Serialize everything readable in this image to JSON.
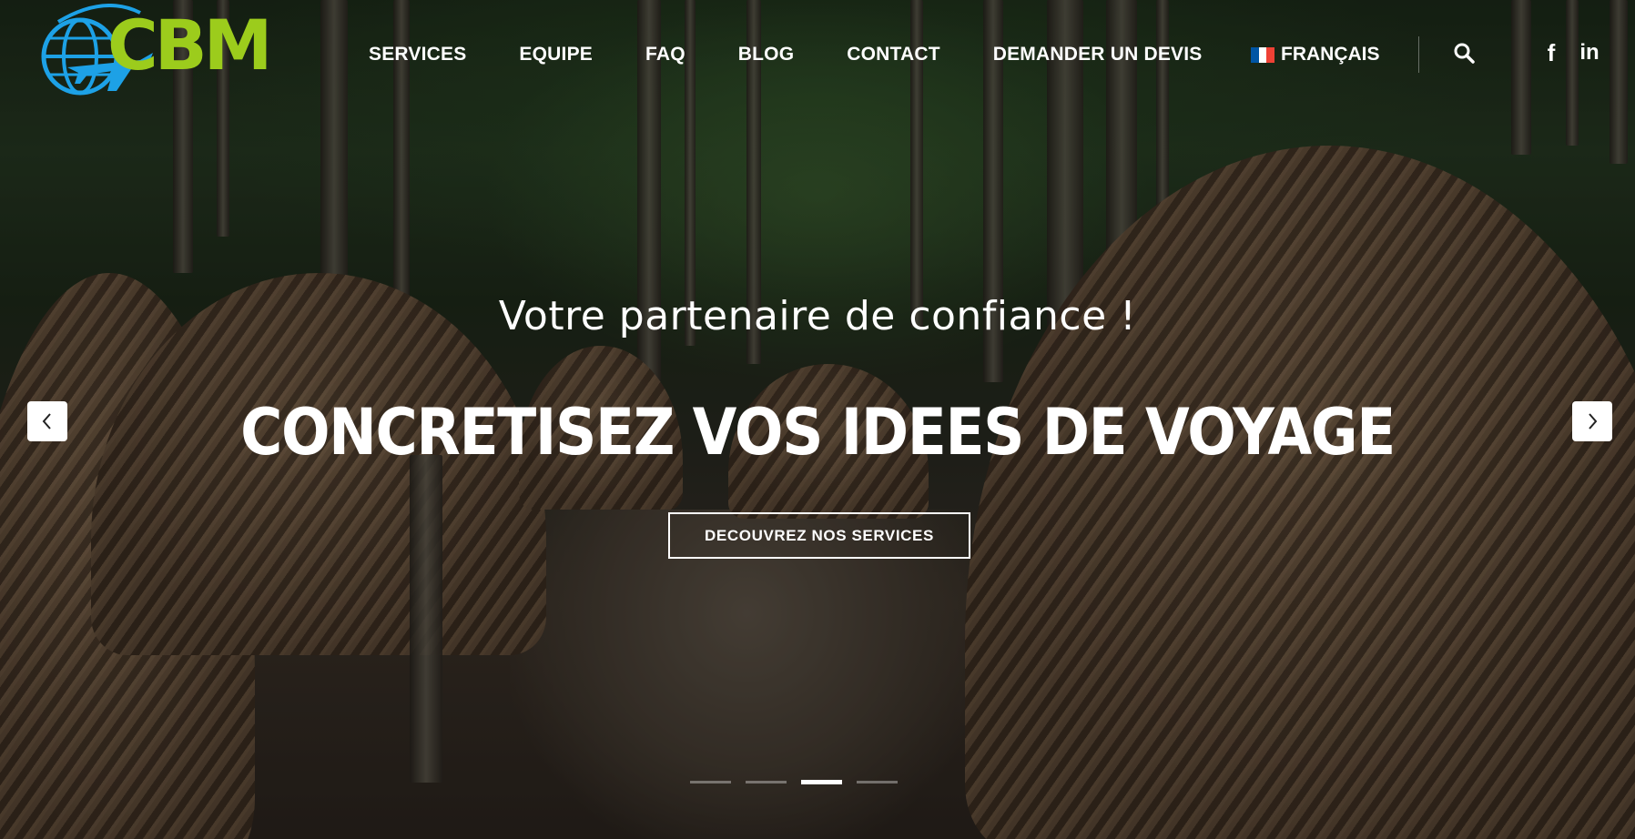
{
  "brand": {
    "logo_text": "CBM",
    "logo_icon": "globe-airplane-icon",
    "colors": {
      "green": "#9ccc1c",
      "blue": "#1da1e6"
    }
  },
  "nav": {
    "items": [
      {
        "label": "SERVICES"
      },
      {
        "label": "EQUIPE"
      },
      {
        "label": "FAQ"
      },
      {
        "label": "BLOG"
      },
      {
        "label": "CONTACT"
      },
      {
        "label": "DEMANDER UN DEVIS"
      }
    ],
    "language": {
      "label": "FRANÇAIS",
      "flag_icon": "france-flag-icon"
    }
  },
  "header_icons": {
    "search": "search-icon",
    "facebook": "facebook-icon",
    "linkedin": "linkedin-icon"
  },
  "hero": {
    "tagline": "Votre partenaire de confiance !",
    "headline": "CONCRETISEZ VOS IDEES DE VOYAGE",
    "cta_label": "DECOUVREZ NOS SERVICES"
  },
  "carousel": {
    "prev_icon": "chevron-left-icon",
    "next_icon": "chevron-right-icon",
    "slide_count": 4,
    "active_index": 2
  }
}
